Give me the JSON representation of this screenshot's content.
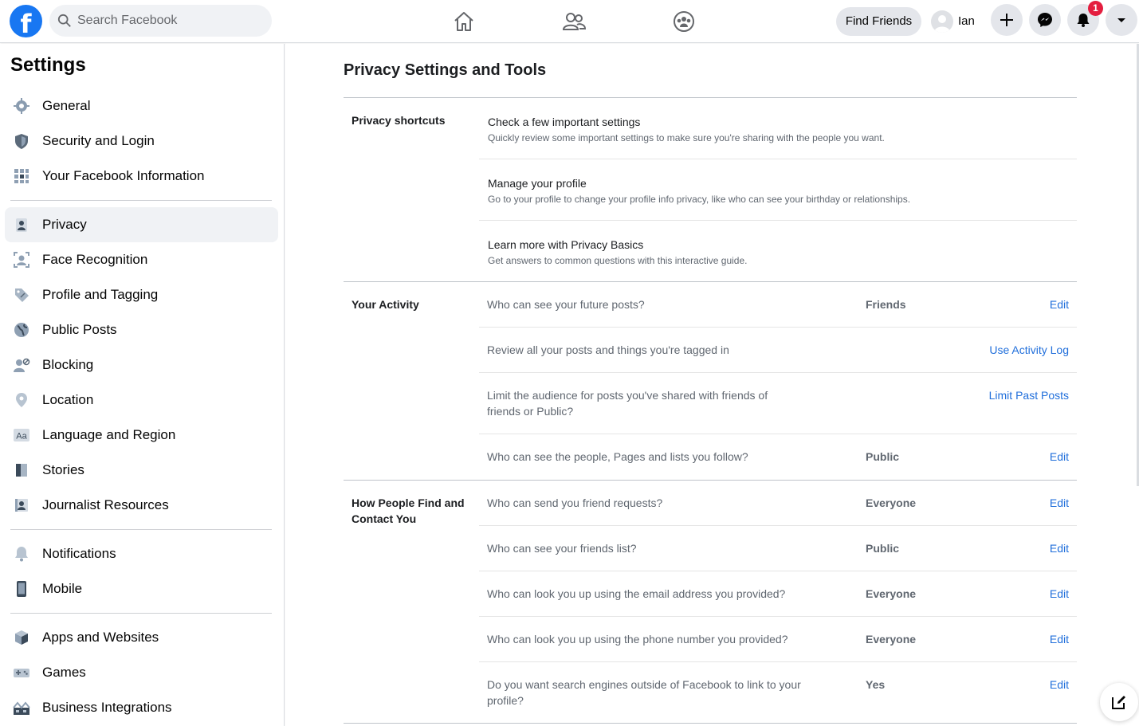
{
  "topbar": {
    "logo": "f",
    "search_placeholder": "Search Facebook",
    "find_friends": "Find Friends",
    "user_name": "Ian",
    "notification_count": "1"
  },
  "sidebar": {
    "title": "Settings",
    "items": [
      {
        "label": "General",
        "icon": "gear-icon"
      },
      {
        "label": "Security and Login",
        "icon": "shield-icon"
      },
      {
        "label": "Your Facebook Information",
        "icon": "grid-icon"
      },
      {
        "label": "Privacy",
        "icon": "lock-person-icon",
        "active": true
      },
      {
        "label": "Face Recognition",
        "icon": "face-scan-icon"
      },
      {
        "label": "Profile and Tagging",
        "icon": "tag-icon"
      },
      {
        "label": "Public Posts",
        "icon": "globe-icon"
      },
      {
        "label": "Blocking",
        "icon": "block-user-icon"
      },
      {
        "label": "Location",
        "icon": "location-pin-icon"
      },
      {
        "label": "Language and Region",
        "icon": "language-icon"
      },
      {
        "label": "Stories",
        "icon": "book-icon"
      },
      {
        "label": "Journalist Resources",
        "icon": "id-card-icon"
      },
      {
        "label": "Notifications",
        "icon": "bell-icon"
      },
      {
        "label": "Mobile",
        "icon": "phone-icon"
      },
      {
        "label": "Apps and Websites",
        "icon": "cube-icon"
      },
      {
        "label": "Games",
        "icon": "gamepad-icon"
      },
      {
        "label": "Business Integrations",
        "icon": "business-icon"
      }
    ]
  },
  "main": {
    "title": "Privacy Settings and Tools",
    "shortcuts": {
      "label": "Privacy shortcuts",
      "items": [
        {
          "title": "Check a few important settings",
          "desc": "Quickly review some important settings to make sure you're sharing with the people you want."
        },
        {
          "title": "Manage your profile",
          "desc": "Go to your profile to change your profile info privacy, like who can see your birthday or relationships."
        },
        {
          "title": "Learn more with Privacy Basics",
          "desc": "Get answers to common questions with this interactive guide."
        }
      ]
    },
    "activity": {
      "label": "Your Activity",
      "rows": [
        {
          "question": "Who can see your future posts?",
          "value": "Friends",
          "action": "Edit"
        },
        {
          "question": "Review all your posts and things you're tagged in",
          "value": "",
          "action": "Use Activity Log"
        },
        {
          "question": "Limit the audience for posts you've shared with friends of friends or Public?",
          "value": "",
          "action": "Limit Past Posts"
        },
        {
          "question": "Who can see the people, Pages and lists you follow?",
          "value": "Public",
          "action": "Edit"
        }
      ]
    },
    "find": {
      "label": "How People Find and Contact You",
      "rows": [
        {
          "question": "Who can send you friend requests?",
          "value": "Everyone",
          "action": "Edit"
        },
        {
          "question": "Who can see your friends list?",
          "value": "Public",
          "action": "Edit"
        },
        {
          "question": "Who can look you up using the email address you provided?",
          "value": "Everyone",
          "action": "Edit"
        },
        {
          "question": "Who can look you up using the phone number you provided?",
          "value": "Everyone",
          "action": "Edit"
        },
        {
          "question": "Do you want search engines outside of Facebook to link to your profile?",
          "value": "Yes",
          "action": "Edit"
        }
      ]
    }
  },
  "colors": {
    "brand": "#1877f2",
    "link": "#216fdb",
    "badge": "#e41e3f"
  }
}
